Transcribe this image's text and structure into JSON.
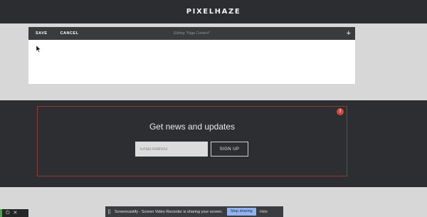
{
  "site": {
    "brand": "PIXELHAZE"
  },
  "editor": {
    "save_label": "SAVE",
    "cancel_label": "CANCEL",
    "title": "Editing \"Page Content\"",
    "add_symbol": "+"
  },
  "newsletter": {
    "heading": "Get news and updates",
    "email_placeholder": "Email Address",
    "signup_label": "SIGN UP",
    "warning_symbol": "!"
  },
  "share_bar": {
    "message": "Screencastify - Screen Video Recorder is sharing your screen.",
    "stop_label": "Stop sharing",
    "hide_label": "Hide"
  },
  "corner_tools": {
    "icons": [
      "power-icon",
      "close-icon"
    ],
    "power_glyph": "⏻",
    "close_glyph": "✕"
  },
  "colors": {
    "header_bg": "#2b2d30",
    "page_bg": "#d8d7d7",
    "warning_red": "#cc4a3e",
    "stop_button_blue": "#8fb4ee"
  }
}
